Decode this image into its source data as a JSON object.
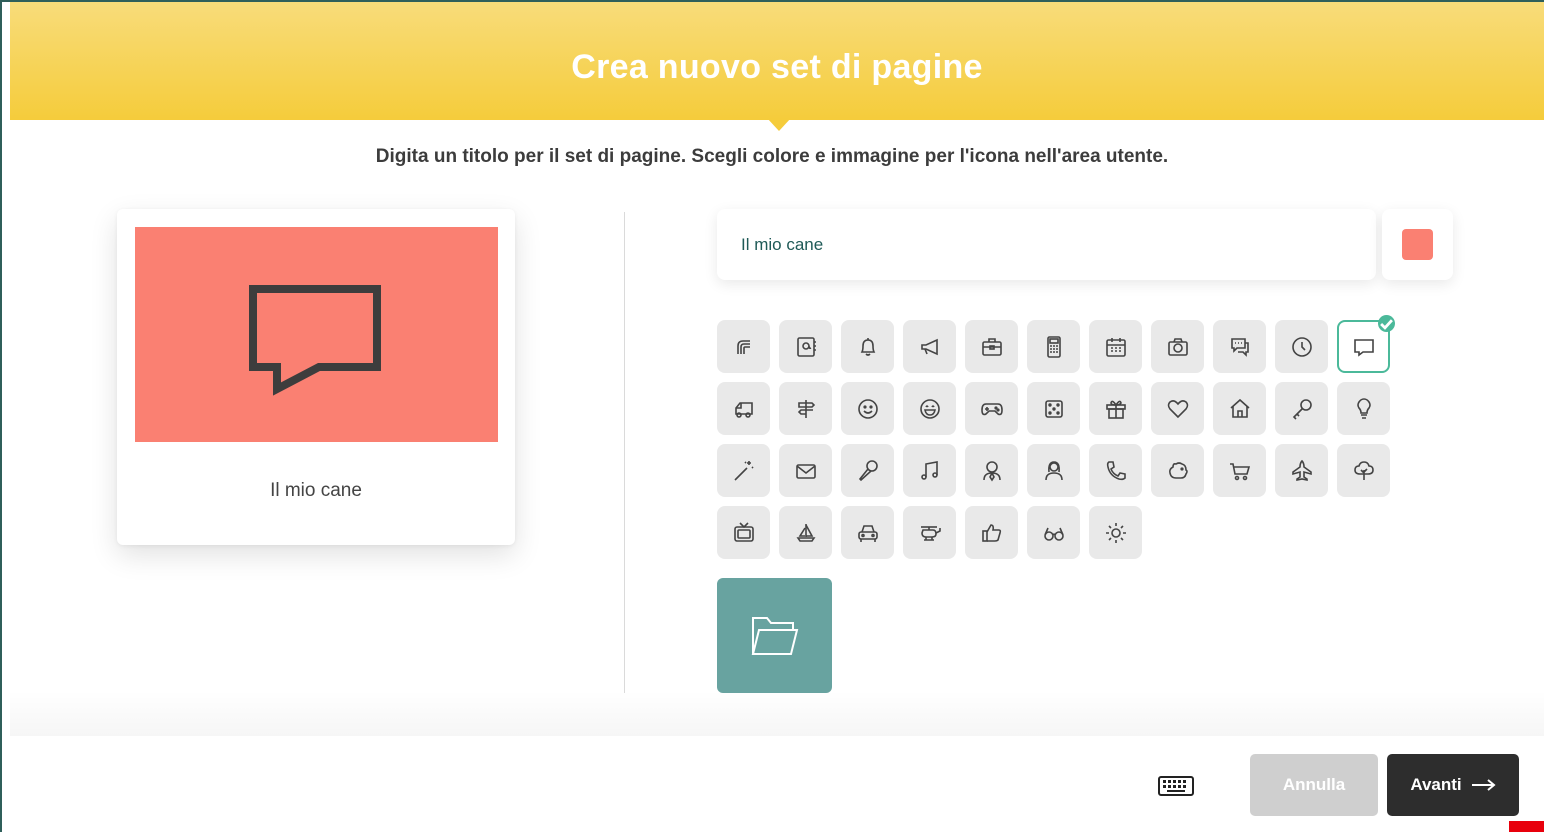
{
  "dialog": {
    "title": "Crea nuovo set di pagine",
    "subtitle": "Digita un titolo per il set di pagine. Scegli colore e immagine per l'icona nell'area utente."
  },
  "preview": {
    "label": "Il mio cane",
    "color": "#fa8072",
    "icon": "speech-bubble-icon"
  },
  "form": {
    "title_value": "Il mio cane",
    "selected_color": "#fa8072"
  },
  "icons": {
    "selected": "speech-bubble",
    "rows": [
      [
        "layers",
        "address-book",
        "bell",
        "megaphone",
        "briefcase",
        "calculator",
        "calendar",
        "camera",
        "chat",
        "clock",
        "speech-bubble"
      ],
      [
        "truck",
        "signpost",
        "smiley",
        "laughing",
        "gamepad",
        "dice",
        "gift",
        "heart",
        "home",
        "key",
        "lightbulb"
      ],
      [
        "magic-wand",
        "envelope",
        "microphone",
        "music-note",
        "person-male",
        "person-female",
        "phone",
        "piggy-bank",
        "shopping-cart",
        "airplane",
        "tree"
      ],
      [
        "tv",
        "sailboat",
        "car",
        "helicopter",
        "thumbs-up",
        "glasses",
        "sun"
      ]
    ]
  },
  "footer": {
    "cancel_label": "Annulla",
    "next_label": "Avanti",
    "cancel_color": "#cfcfcf",
    "next_color": "#2d2d2d"
  },
  "folder_tile_color": "#68a3a0"
}
